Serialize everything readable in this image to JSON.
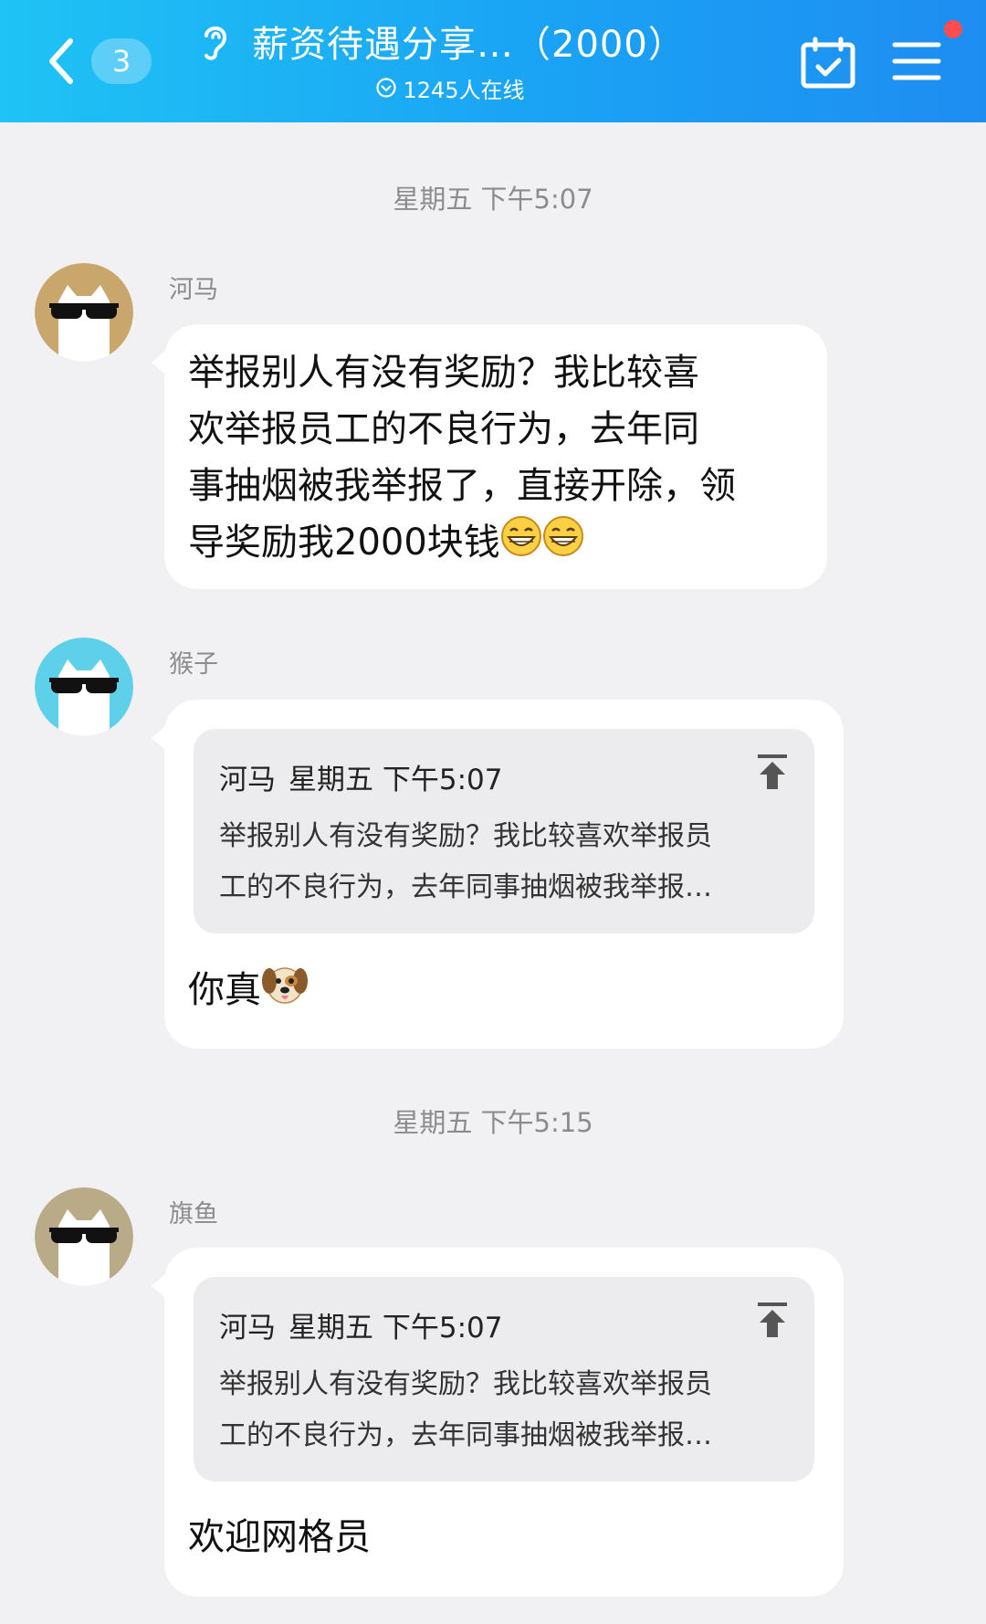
{
  "header": {
    "unread_count": "3",
    "group_title": "薪资待遇分享…（2000）",
    "online": "1245人在线",
    "icons": [
      "back-chevron-icon",
      "ear-icon",
      "calendar-check-icon",
      "menu-icon"
    ]
  },
  "colors": {
    "header_start": "#1fc3f5",
    "header_end": "#1e8df2",
    "background": "#f1f1f3",
    "bubble": "#ffffff",
    "notification_dot": "#ff4d4f"
  },
  "timeline": [
    {
      "timestamp": "星期五 下午5:07"
    },
    {
      "timestamp": "星期五 下午5:15"
    }
  ],
  "messages": [
    {
      "sender": "河马",
      "avatar": "cat-sunglasses-tan-avatar",
      "lines": [
        "举报别人有没有奖励？我比较喜",
        "欢举报员工的不良行为，去年同",
        "事抽烟被我举报了，直接开除，领",
        "导奖励我2000块钱"
      ],
      "emojis": [
        "grinning-face-emoji",
        "grinning-face-emoji"
      ]
    },
    {
      "sender": "猴子",
      "avatar": "cat-sunglasses-blue-avatar",
      "quote": {
        "author": "河马",
        "time": "星期五 下午5:07",
        "line1": "举报别人有没有奖励？我比较喜欢举报员",
        "line2": "工的不良行为，去年同事抽烟被我举报…"
      },
      "text": "你真",
      "emoji": "dog-face-emoji"
    },
    {
      "sender": "旗鱼",
      "avatar": "cat-sunglasses-olive-avatar",
      "quote": {
        "author": "河马",
        "time": "星期五 下午5:07",
        "line1": "举报别人有没有奖励？我比较喜欢举报员",
        "line2": "工的不良行为，去年同事抽烟被我举报…"
      },
      "text": "欢迎网格员"
    }
  ]
}
